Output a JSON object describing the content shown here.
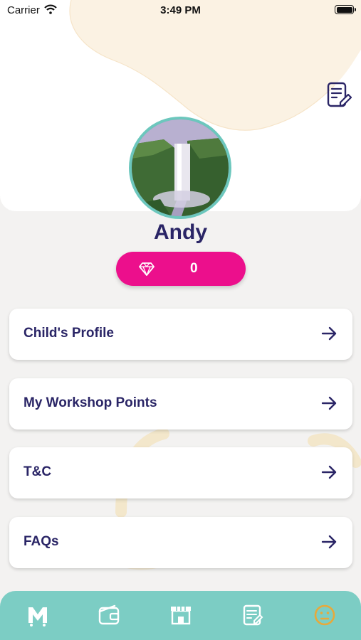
{
  "status_bar": {
    "carrier": "Carrier",
    "time": "3:49 PM"
  },
  "profile": {
    "name": "Andy",
    "points": "0",
    "edit_icon": "edit-document-icon",
    "points_icon": "diamond-icon"
  },
  "menu": [
    {
      "label": "Child's Profile",
      "icon": "arrow-right-icon"
    },
    {
      "label": "My Workshop Points",
      "icon": "arrow-right-icon"
    },
    {
      "label": "T&C",
      "icon": "arrow-right-icon"
    },
    {
      "label": "FAQs",
      "icon": "arrow-right-icon"
    }
  ],
  "tab_bar": {
    "tabs": [
      {
        "icon": "home-logo-icon",
        "active": false
      },
      {
        "icon": "wallet-icon",
        "active": false
      },
      {
        "icon": "store-icon",
        "active": false
      },
      {
        "icon": "edit-list-icon",
        "active": false
      },
      {
        "icon": "smiley-face-icon",
        "active": true
      }
    ]
  },
  "colors": {
    "accent_pink": "#ec0f8c",
    "primary_navy": "#2a2566",
    "teal": "#7ccdc4",
    "active_tab": "#e7a93b"
  }
}
